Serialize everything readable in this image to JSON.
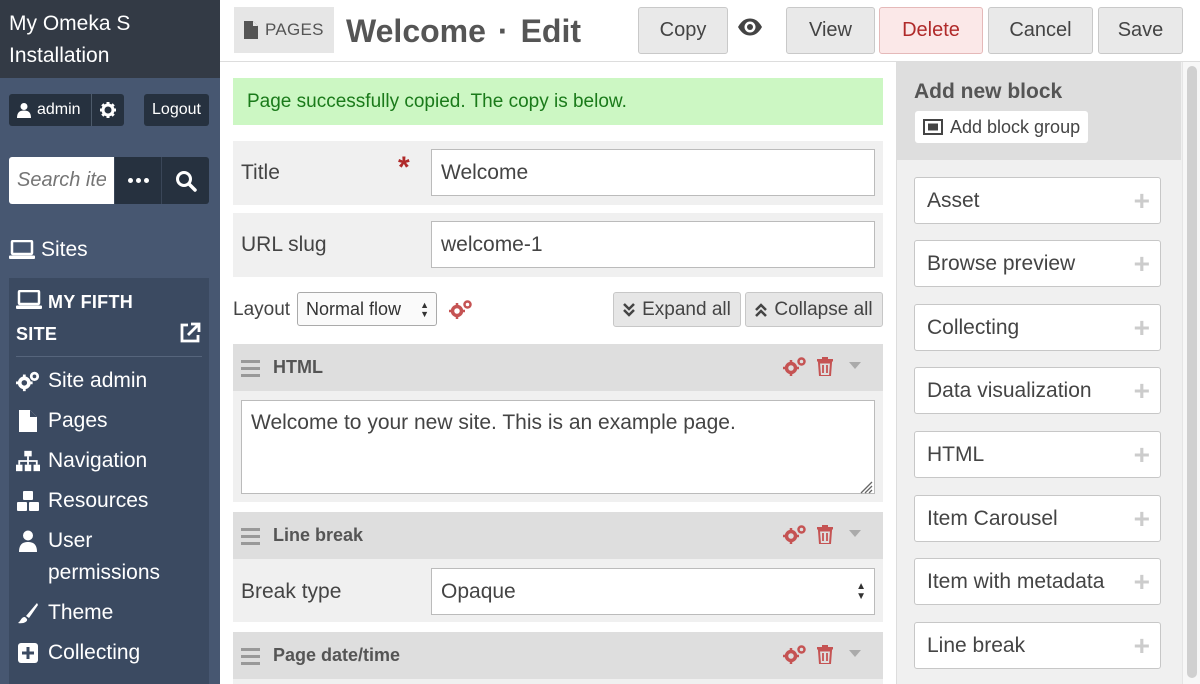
{
  "app": {
    "installation_name": "My Omeka S Installation"
  },
  "user": {
    "name": "admin",
    "logout_label": "Logout"
  },
  "search": {
    "placeholder": "Search items"
  },
  "sidebar": {
    "sites_label": "Sites",
    "site_name": "MY FIFTH SITE",
    "nav": [
      {
        "label": "Site admin",
        "icon": "gears-icon"
      },
      {
        "label": "Pages",
        "icon": "file-icon"
      },
      {
        "label": "Navigation",
        "icon": "sitemap-icon"
      },
      {
        "label": "Resources",
        "icon": "cubes-icon"
      },
      {
        "label": "User permissions",
        "icon": "user-icon"
      },
      {
        "label": "Theme",
        "icon": "paintbrush-icon"
      },
      {
        "label": "Collecting",
        "icon": "plus-square-icon"
      }
    ]
  },
  "header": {
    "section": "PAGES",
    "title": "Welcome",
    "subtitle": "Edit",
    "buttons": {
      "copy": "Copy",
      "view": "View",
      "delete": "Delete",
      "cancel": "Cancel",
      "save": "Save"
    }
  },
  "main": {
    "success_message": "Page successfully copied. The copy is below.",
    "title_label": "Title",
    "title_value": "Welcome",
    "slug_label": "URL slug",
    "slug_value": "welcome-1",
    "layout_label": "Layout",
    "layout_value": "Normal flow",
    "expand_all": "Expand all",
    "collapse_all": "Collapse all",
    "blocks": {
      "html": {
        "name": "HTML",
        "content": "Welcome to your new site. This is an example page."
      },
      "line_break": {
        "name": "Line break",
        "field_label": "Break type",
        "field_value": "Opaque"
      },
      "datetime": {
        "name": "Page date/time"
      }
    }
  },
  "right_panel": {
    "title": "Add new block",
    "add_group": "Add block group",
    "block_types": [
      "Asset",
      "Browse preview",
      "Collecting",
      "Data visualization",
      "HTML",
      "Item Carousel",
      "Item with metadata",
      "Line break"
    ]
  },
  "colors": {
    "sidebar_bg": "#475771",
    "sidebar_top": "#333a45",
    "success_bg": "#ccf7c3",
    "success_text": "#1a7a1a",
    "danger": "#b02a2a",
    "accent_icon": "#c55353"
  }
}
